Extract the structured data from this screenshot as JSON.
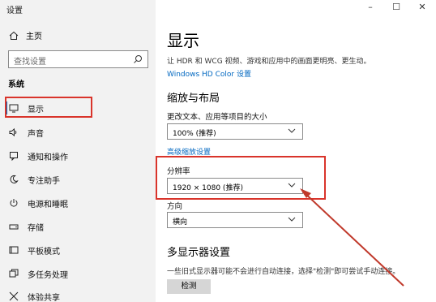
{
  "window": {
    "title": "设置",
    "controls": [
      "–",
      "☐",
      "✕"
    ]
  },
  "sidebar": {
    "home_label": "主页",
    "search_placeholder": "查找设置",
    "section": "系统",
    "items": [
      {
        "label": "显示",
        "icon": "monitor-icon"
      },
      {
        "label": "声音",
        "icon": "speaker-icon"
      },
      {
        "label": "通知和操作",
        "icon": "notification-icon"
      },
      {
        "label": "专注助手",
        "icon": "moon-icon"
      },
      {
        "label": "电源和睡眠",
        "icon": "power-icon"
      },
      {
        "label": "存储",
        "icon": "storage-icon"
      },
      {
        "label": "平板模式",
        "icon": "tablet-icon"
      },
      {
        "label": "多任务处理",
        "icon": "multitask-icon"
      },
      {
        "label": "体验共享",
        "icon": "share-icon"
      }
    ]
  },
  "main": {
    "title": "显示",
    "description": "让 HDR 和 WCG 视频、游戏和应用中的画面更明亮、更生动。",
    "hdr_link": "Windows HD Color 设置",
    "scale_heading": "缩放与布局",
    "scale_label": "更改文本、应用等项目的大小",
    "scale_value": "100% (推荐)",
    "advanced_scale_link": "高级缩放设置",
    "resolution_label": "分辨率",
    "resolution_value": "1920 × 1080 (推荐)",
    "orientation_label": "方向",
    "orientation_value": "横向",
    "multi_heading": "多显示器设置",
    "multi_desc": "一些旧式显示器可能不会进行自动连接，选择\"检测\"即可尝试手动连接。",
    "detect_button": "检测"
  },
  "colors": {
    "accent": "#0067c0",
    "annotation": "#d9342b"
  }
}
